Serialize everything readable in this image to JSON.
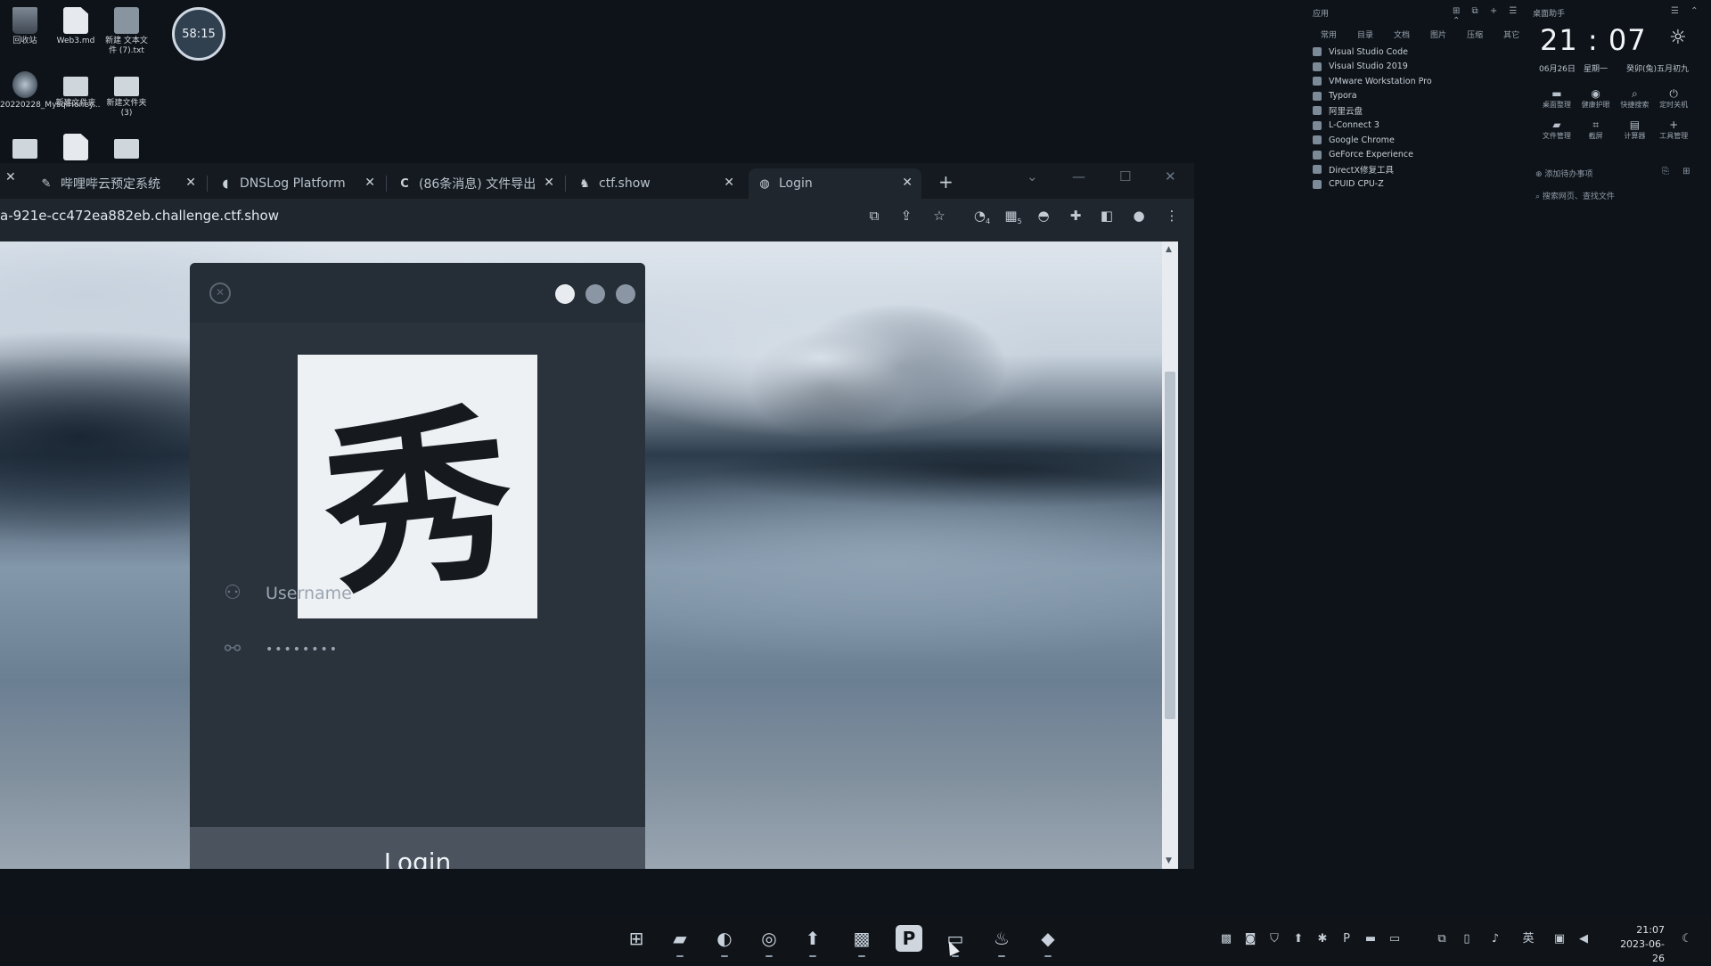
{
  "desktop": {
    "icons": [
      {
        "label": "回收站",
        "icon": "recycle-bin"
      },
      {
        "label": "Web3.md",
        "icon": "document"
      },
      {
        "label": "新建 文本文件 (7).txt",
        "icon": "text-file"
      },
      {
        "label": "20220228_MysqlHoney...",
        "icon": "zip-archive"
      },
      {
        "label": "新建文件夹",
        "icon": "folder"
      },
      {
        "label": "新建文件夹 (3)",
        "icon": "folder"
      },
      {
        "label": "",
        "icon": "folder"
      },
      {
        "label": "",
        "icon": "document"
      },
      {
        "label": "",
        "icon": "folder"
      }
    ],
    "timer_badge": "58:15"
  },
  "browser": {
    "tabs": [
      {
        "title": "哔哩哔云预定系统",
        "icon": "bookmark-icon",
        "close": "✕"
      },
      {
        "title": "DNSLog Platform",
        "icon": "dns-icon",
        "close": "✕"
      },
      {
        "title": "(86条消息) 文件导出",
        "icon": "csdn-icon",
        "close": "✕"
      },
      {
        "title": "ctf.show",
        "icon": "ctfshow-icon",
        "close": "✕"
      },
      {
        "title": "Login",
        "icon": "globe-icon",
        "close": "✕",
        "active": true
      }
    ],
    "url": "a-921e-cc472ea882eb.challenge.ctf.show",
    "toolbar_badges": {
      "extension_a": "4",
      "extension_b": "5"
    }
  },
  "login": {
    "logo_char": "秀",
    "username_placeholder": "Username",
    "password_value": "••••••••",
    "button_label": "Login",
    "dot_colors": [
      "#e8ecf0",
      "#8a96a3",
      "#8a96a3"
    ]
  },
  "app_panel": {
    "title": "应用",
    "categories": [
      "常用",
      "目录",
      "文档",
      "图片",
      "压缩",
      "其它"
    ],
    "apps": [
      "Visual Studio Code",
      "Visual Studio 2019",
      "VMware Workstation Pro",
      "Typora",
      "阿里云盘",
      "L-Connect 3",
      "Google Chrome",
      "GeForce Experience",
      "DirectX修复工具",
      "CPUID CPU-Z"
    ]
  },
  "clock_panel": {
    "title": "桌面助手",
    "time": "21 : 07",
    "date": "06月26日",
    "weekday": "星期一",
    "lunar": "癸卯(兔)五月初九",
    "actions": [
      "桌面整理",
      "健康护眼",
      "快捷搜索",
      "定时关机",
      "文件管理",
      "截屏",
      "计算器",
      "工具管理"
    ],
    "todo": "添加待办事项",
    "search": "搜索网页、查找文件"
  },
  "taskbar": {
    "apps": [
      "windows-start",
      "file-explorer",
      "edge-browser",
      "chrome-browser",
      "tool-app",
      "monitor-app",
      "powerpoint-app",
      "terminal-app",
      "steam-app",
      "games-app"
    ],
    "ime": "英",
    "clock_time": "21:07",
    "clock_date": "2023-06-26"
  }
}
